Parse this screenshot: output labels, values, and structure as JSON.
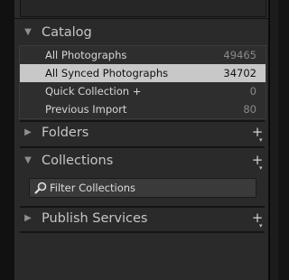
{
  "panel": {
    "sections": {
      "catalog": {
        "title": "Catalog",
        "items": [
          {
            "label": "All Photographs",
            "count": "49465"
          },
          {
            "label": "All Synced Photographs",
            "count": "34702"
          },
          {
            "label": "Quick Collection +",
            "count": "0"
          },
          {
            "label": "Previous Import",
            "count": "80"
          }
        ]
      },
      "folders": {
        "title": "Folders",
        "add_label": "+",
        "menu_label": "▾"
      },
      "collections": {
        "title": "Collections",
        "add_label": "+",
        "menu_label": "▾",
        "search_placeholder": "Filter Collections"
      },
      "publish_services": {
        "title": "Publish Services",
        "add_label": "+",
        "menu_label": "▾"
      }
    },
    "expander_icons": {
      "expanded": "triangle-down",
      "collapsed": "triangle-right"
    },
    "colors": {
      "panel_bg": "#2a2a2a",
      "selected_bg": "#c8c8c8",
      "text": "#d6d6d6",
      "header_text": "#c6c6c6",
      "count_text": "#8a8a8a"
    }
  }
}
